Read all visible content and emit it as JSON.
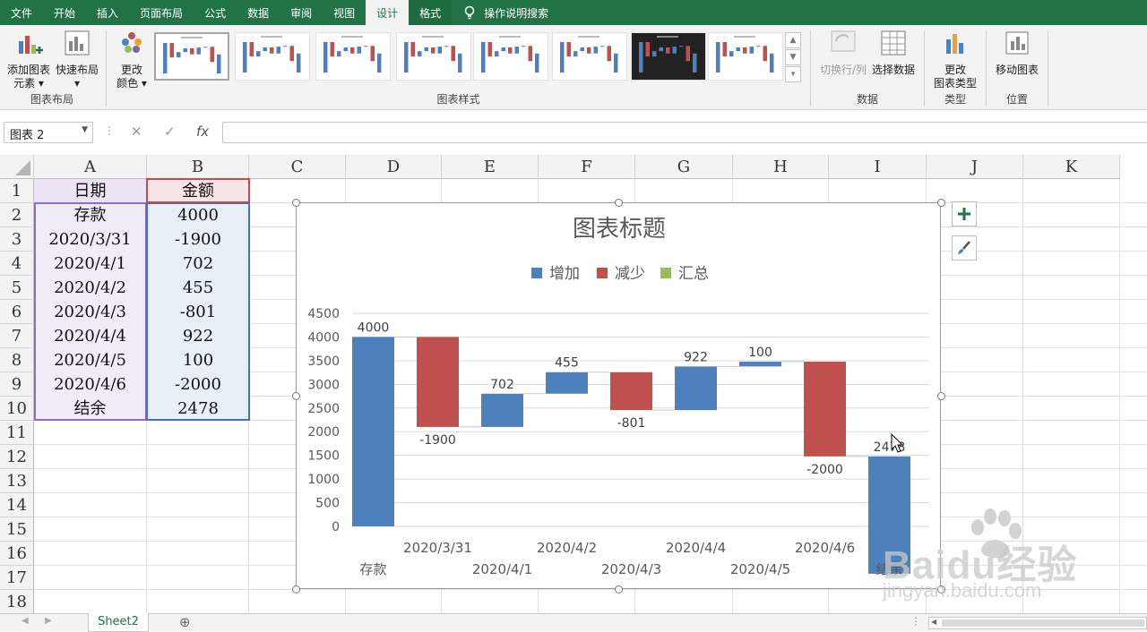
{
  "tabs": [
    "文件",
    "开始",
    "插入",
    "页面布局",
    "公式",
    "数据",
    "审阅",
    "视图",
    "设计",
    "格式"
  ],
  "active_tab": "设计",
  "search_tab": "操作说明搜索",
  "ribbon": {
    "add_element": "添加图表",
    "add_element2": "元素",
    "quick_layout": "快速布局",
    "change_color": "更改",
    "change_color2": "颜色",
    "group_layout": "图表布局",
    "group_styles": "图表样式",
    "switch_rowcol": "切换行/列",
    "select_data": "选择数据",
    "group_data": "数据",
    "change_type": "更改",
    "change_type2": "图表类型",
    "group_type": "类型",
    "move_chart": "移动图表",
    "group_location": "位置"
  },
  "formula": {
    "name_box": "图表 2",
    "fx": "fx",
    "cancel": "✕",
    "enter": "✓",
    "value": ""
  },
  "columns": [
    "A",
    "B",
    "C",
    "D",
    "E",
    "F",
    "G",
    "H",
    "I",
    "J",
    "K"
  ],
  "rows": [
    "1",
    "2",
    "3",
    "4",
    "5",
    "6",
    "7",
    "8",
    "9",
    "10",
    "11",
    "12",
    "13",
    "14",
    "15",
    "16",
    "17",
    "18"
  ],
  "table": {
    "header": [
      "日期",
      "金额"
    ],
    "rows": [
      [
        "存款",
        "4000"
      ],
      [
        "2020/3/31",
        "-1900"
      ],
      [
        "2020/4/1",
        "702"
      ],
      [
        "2020/4/2",
        "455"
      ],
      [
        "2020/4/3",
        "-801"
      ],
      [
        "2020/4/4",
        "922"
      ],
      [
        "2020/4/5",
        "100"
      ],
      [
        "2020/4/6",
        "-2000"
      ],
      [
        "结余",
        "2478"
      ]
    ]
  },
  "chart_data": {
    "type": "waterfall",
    "title": "图表标题",
    "legend": [
      {
        "name": "增加",
        "color": "#4e80bd"
      },
      {
        "name": "减少",
        "color": "#c0504d"
      },
      {
        "name": "汇总",
        "color": "#9bbb59"
      }
    ],
    "legend_position": "top",
    "categories": [
      "存款",
      "2020/3/31",
      "2020/4/1",
      "2020/4/2",
      "2020/4/3",
      "2020/4/4",
      "2020/4/5",
      "2020/4/6",
      "结余"
    ],
    "values": [
      4000,
      -1900,
      702,
      455,
      -801,
      922,
      100,
      -2000,
      2478
    ],
    "data_labels": [
      "4000",
      "-1900",
      "702",
      "455",
      "-801",
      "922",
      "100",
      "-2000",
      "2478"
    ],
    "ylim": [
      0,
      4500
    ],
    "yticks": [
      "0",
      "500",
      "1000",
      "1500",
      "2000",
      "2500",
      "3000",
      "3500",
      "4000",
      "4500"
    ],
    "grid": true,
    "colors": {
      "up": "#4e80bd",
      "down": "#c0504d",
      "total": "#9bbb59"
    }
  },
  "sheets": [
    "Sheet2"
  ],
  "watermark": {
    "line1": "Baidu经验",
    "line2": "jingyan.baidu.com"
  }
}
